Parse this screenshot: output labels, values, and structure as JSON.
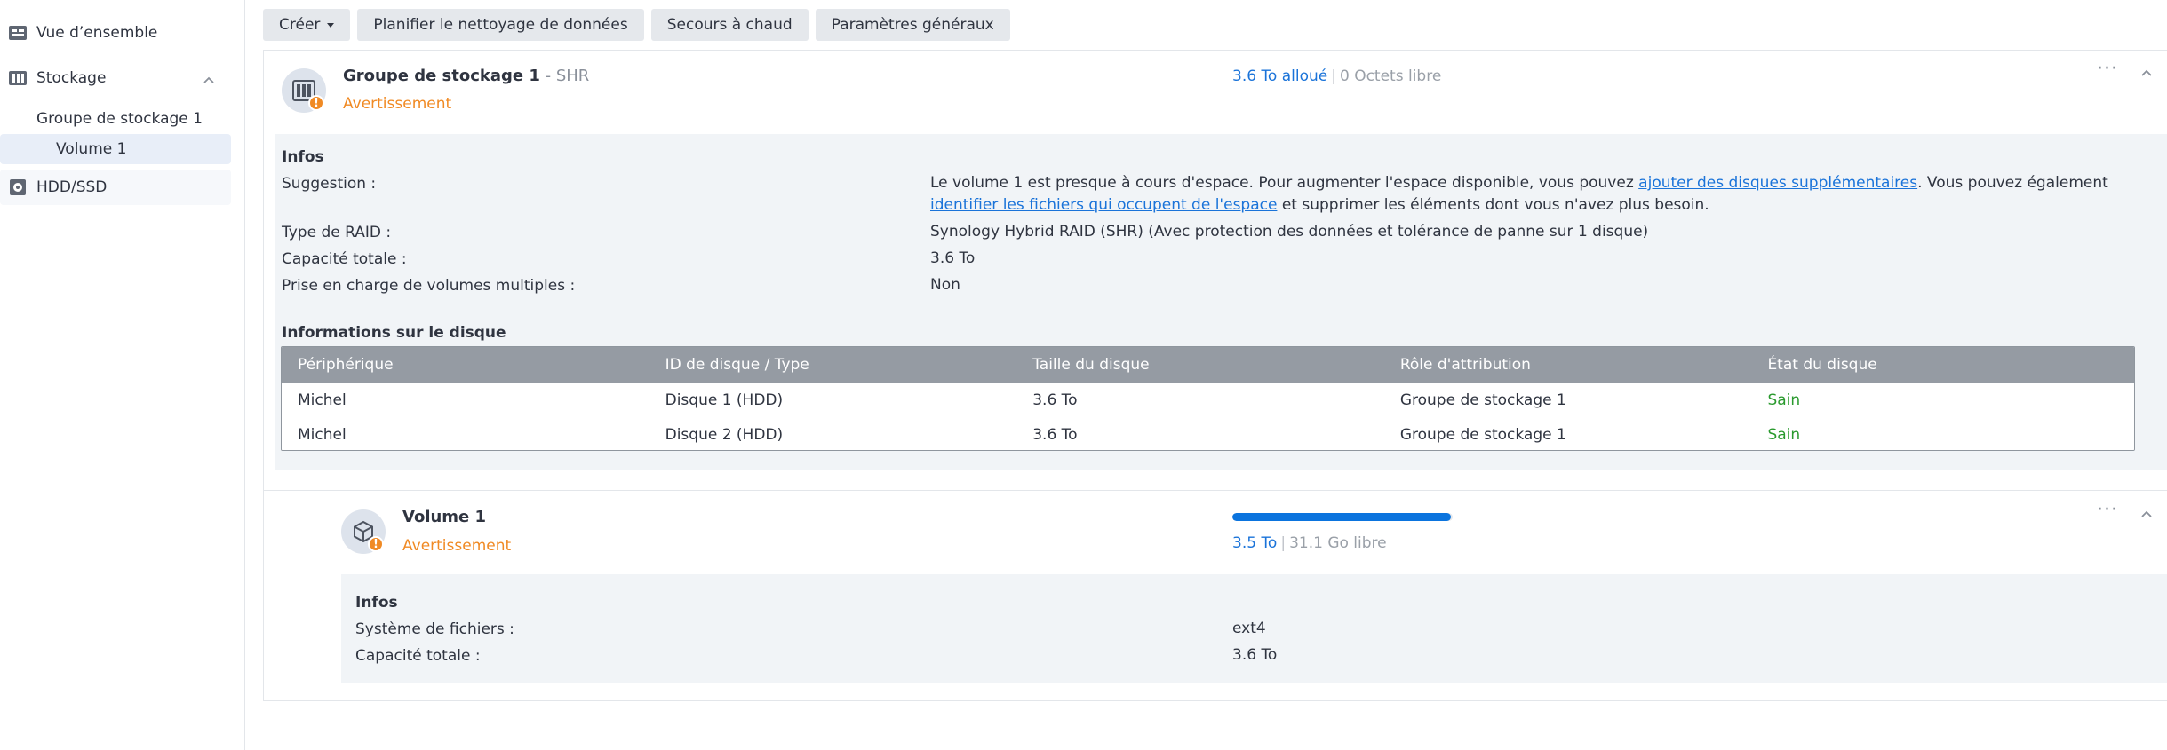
{
  "sidebar": {
    "overview": "Vue d’ensemble",
    "storage": "Stockage",
    "pool": "Groupe de stockage 1",
    "volume": "Volume 1",
    "hdd": "HDD/SSD"
  },
  "toolbar": {
    "create": "Créer",
    "schedule": "Planifier le nettoyage de données",
    "hotspare": "Secours à chaud",
    "settings": "Paramètres généraux"
  },
  "pool": {
    "name": "Groupe de stockage 1",
    "suffix": " - SHR",
    "status": "Avertissement",
    "allocated": "3.6 To alloué",
    "free": "0 Octets libre",
    "info_title": "Infos",
    "suggestion_label": "Suggestion :",
    "suggestion_text_1": "Le volume 1 est presque à cours d'espace. Pour augmenter l'espace disponible, vous pouvez ",
    "suggestion_link_1": "ajouter des disques supplémentaires",
    "suggestion_text_2": ". Vous pouvez également ",
    "suggestion_link_2": "identifier les fichiers qui occupent de l'espace",
    "suggestion_text_3": " et supprimer les éléments dont vous n'avez plus besoin.",
    "raid_label": "Type de RAID :",
    "raid_value": "Synology Hybrid RAID (SHR) (Avec protection des données et tolérance de panne sur 1 disque)",
    "capacity_label": "Capacité totale :",
    "capacity_value": "3.6 To",
    "multi_label": "Prise en charge de volumes multiples :",
    "multi_value": "Non",
    "disk_title": "Informations sur le disque",
    "columns": [
      "Périphérique",
      "ID de disque / Type",
      "Taille du disque",
      "Rôle d'attribution",
      "État du disque"
    ],
    "rows": [
      [
        "Michel",
        "Disque 1 (HDD)",
        "3.6 To",
        "Groupe de stockage 1",
        "Sain"
      ],
      [
        "Michel",
        "Disque 2 (HDD)",
        "3.6 To",
        "Groupe de stockage 1",
        "Sain"
      ]
    ]
  },
  "volume": {
    "name": "Volume 1",
    "status": "Avertissement",
    "used": "3.5 To",
    "free": "31.1 Go libre",
    "usage_fraction": 0.99,
    "info_title": "Infos",
    "fs_label": "Système de fichiers :",
    "fs_value": "ext4",
    "capacity_label": "Capacité totale :",
    "capacity_value": "3.6 To"
  },
  "colors": {
    "accent": "#1a73d9",
    "warning": "#f08a24",
    "healthy": "#2a9a2e"
  }
}
